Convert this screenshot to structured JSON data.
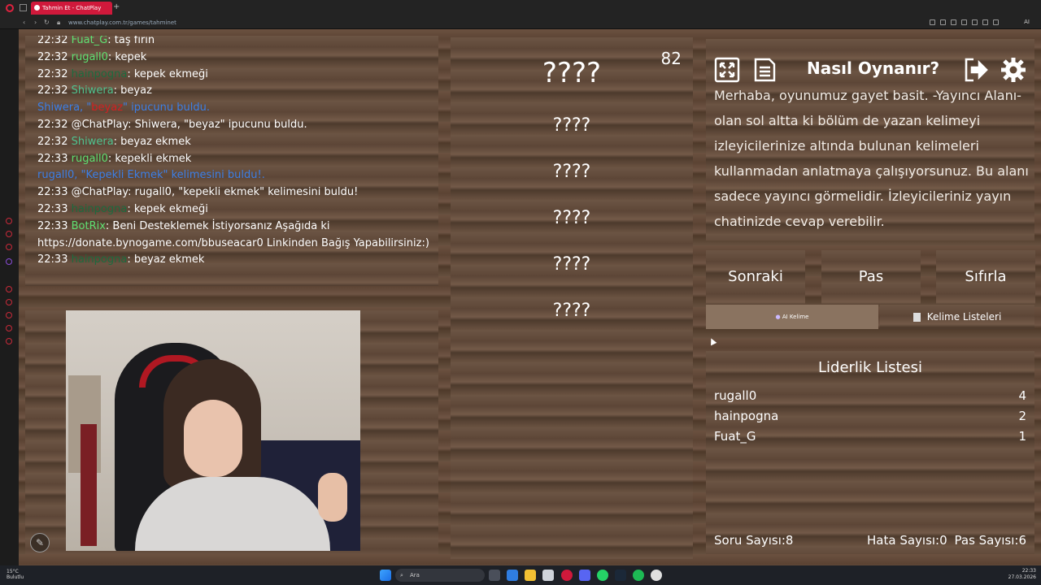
{
  "browser": {
    "tab_title": "Tahmin Et - ChatPlay",
    "new_tab": "+",
    "url": "www.chatplay.com.tr/games/tahminet",
    "ai_label": "AI"
  },
  "chat": {
    "messages": [
      {
        "time": "22:32",
        "name": "Fuat_G",
        "text": ": taş fırın",
        "color": "green"
      },
      {
        "time": "22:32",
        "name": "rugall0",
        "text": ": kepek",
        "color": "green"
      },
      {
        "time": "22:32",
        "name": "hainpogna",
        "text": ": kepek ekmeği",
        "color": "dark"
      },
      {
        "time": "22:32",
        "name": "Shiwera",
        "text": ": beyaz",
        "color": "teal"
      }
    ],
    "sys1_a": "Shiwera, \"",
    "sys1_red": "beyaz",
    "sys1_b": "\" ipucunu buldu.",
    "m5": "22:32 @ChatPlay: Shiwera, \"beyaz\" ipucunu buldu.",
    "m6_time": "22:32",
    "m6_name": "Shiwera",
    "m6_text": ": beyaz ekmek",
    "m7_time": "22:33",
    "m7_name": "rugall0",
    "m7_text": ": kepekli ekmek",
    "sys2": "rugall0, \"Kepekli Ekmek\" kelimesini buldu!.",
    "m9": "22:33 @ChatPlay: rugall0, \"kepekli ekmek\" kelimesini buldu!",
    "m10_time": "22:33",
    "m10_name": "hainpogna",
    "m10_text": ": kepek ekmeği",
    "m11_time": "22:33",
    "m11_name": "BotRix",
    "m11_text": ": Beni Desteklemek İstiyorsanız Aşağıda ki",
    "m11_cont": "https://donate.bynogame.com/bbuseacar0 Linkinden Bağış Yapabilirsiniz:)",
    "m12_time": "22:33",
    "m12_name": "hainpogna",
    "m12_text": ": beyaz ekmek"
  },
  "game": {
    "counter": "82",
    "main_word": "????",
    "hints": [
      "????",
      "????",
      "????",
      "????",
      "????"
    ]
  },
  "howto": {
    "title": "Nasıl Oynanır?",
    "text": "Merhaba, oyunumuz gayet basit. -Yayıncı Alanı- olan sol altta ki bölüm de yazan kelimeyi izleyicilerinize altında bulunan kelimeleri kullanmadan anlatmaya çalışıyorsunuz. Bu alanı sadece yayıncı görmelidir. İzleyicileriniz yayın chatinizde cevap verebilir.",
    "icons": {
      "fullscreen": "fullscreen-icon",
      "list": "document-icon",
      "exit": "exit-icon",
      "settings": "gear-icon"
    }
  },
  "controls": {
    "next": "Sonraki",
    "pass": "Pas",
    "reset": "Sıfırla",
    "ai_word": "AI Kelime",
    "word_lists": "Kelime Listeleri"
  },
  "leaderboard": {
    "title": "Liderlik Listesi",
    "rows": [
      {
        "name": "rugall0",
        "score": "4"
      },
      {
        "name": "hainpogna",
        "score": "2"
      },
      {
        "name": "Fuat_G",
        "score": "1"
      }
    ]
  },
  "stats": {
    "questions": "Soru Sayısı:8",
    "errors": "Hata Sayısı:0",
    "passes": "Pas Sayısı:6"
  },
  "taskbar": {
    "temp": "15°C",
    "weather": "Bulutlu",
    "search": "Ara",
    "time": "22:33",
    "date": "27.03.2026"
  },
  "colors": {
    "system_blue": "#3c7fe6",
    "name_green": "#5fe072",
    "accent_red": "#d0193b"
  }
}
